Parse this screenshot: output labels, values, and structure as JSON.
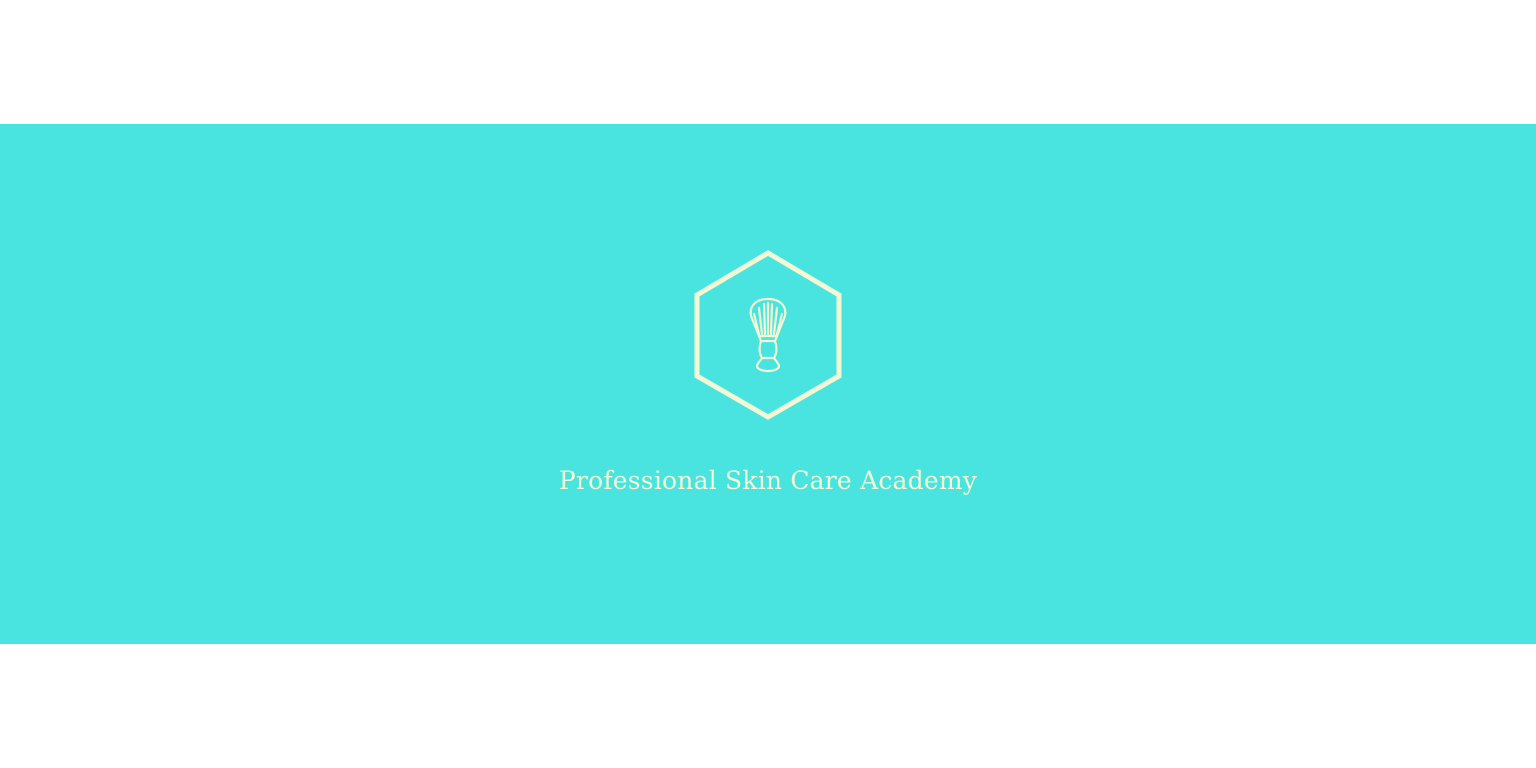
{
  "brand": {
    "name": "Professional Skin Care Academy",
    "logo_icon": "shaving-brush-icon"
  },
  "colors": {
    "banner_background": "#4ae4e0",
    "logo_and_text": "#f3f7d3",
    "page_background": "#ffffff"
  }
}
